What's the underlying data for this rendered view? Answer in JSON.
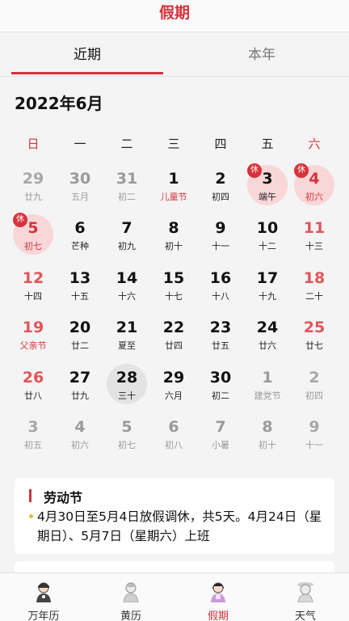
{
  "header": {
    "title": "假期"
  },
  "tabs": [
    {
      "label": "近期",
      "active": true
    },
    {
      "label": "本年",
      "active": false
    }
  ],
  "month_title": "2022年6月",
  "weekdays": [
    "日",
    "一",
    "二",
    "三",
    "四",
    "五",
    "六"
  ],
  "holiday_badge": "休",
  "days": [
    {
      "n": "29",
      "s": "廿九",
      "other": true
    },
    {
      "n": "30",
      "s": "五月",
      "other": true
    },
    {
      "n": "31",
      "s": "初二",
      "other": true
    },
    {
      "n": "1",
      "s": "儿童节",
      "fest": true
    },
    {
      "n": "2",
      "s": "初四"
    },
    {
      "n": "3",
      "s": "端午",
      "rest": true
    },
    {
      "n": "4",
      "s": "初六",
      "rest": true,
      "holidayNum": true
    },
    {
      "n": "5",
      "s": "初七",
      "rest": true,
      "holidayNum": true
    },
    {
      "n": "6",
      "s": "芒种"
    },
    {
      "n": "7",
      "s": "初九"
    },
    {
      "n": "8",
      "s": "初十"
    },
    {
      "n": "9",
      "s": "十一"
    },
    {
      "n": "10",
      "s": "十二"
    },
    {
      "n": "11",
      "s": "十三"
    },
    {
      "n": "12",
      "s": "十四"
    },
    {
      "n": "13",
      "s": "十五"
    },
    {
      "n": "14",
      "s": "十六"
    },
    {
      "n": "15",
      "s": "十七"
    },
    {
      "n": "16",
      "s": "十八"
    },
    {
      "n": "17",
      "s": "十九"
    },
    {
      "n": "18",
      "s": "二十"
    },
    {
      "n": "19",
      "s": "父亲节",
      "fest": true
    },
    {
      "n": "20",
      "s": "廿二"
    },
    {
      "n": "21",
      "s": "夏至"
    },
    {
      "n": "22",
      "s": "廿四"
    },
    {
      "n": "23",
      "s": "廿五"
    },
    {
      "n": "24",
      "s": "廿六"
    },
    {
      "n": "25",
      "s": "廿七"
    },
    {
      "n": "26",
      "s": "廿八"
    },
    {
      "n": "27",
      "s": "廿九"
    },
    {
      "n": "28",
      "s": "三十",
      "today": true
    },
    {
      "n": "29",
      "s": "六月"
    },
    {
      "n": "30",
      "s": "初二"
    },
    {
      "n": "1",
      "s": "建党节",
      "other": true
    },
    {
      "n": "2",
      "s": "初四",
      "other": true
    },
    {
      "n": "3",
      "s": "初五",
      "other": true
    },
    {
      "n": "4",
      "s": "初六",
      "other": true
    },
    {
      "n": "5",
      "s": "初七",
      "other": true
    },
    {
      "n": "6",
      "s": "初八",
      "other": true
    },
    {
      "n": "7",
      "s": "小暑",
      "other": true
    },
    {
      "n": "8",
      "s": "初十",
      "other": true
    },
    {
      "n": "9",
      "s": "十一",
      "other": true
    }
  ],
  "holiday_card": {
    "name": "劳动节",
    "description": "4月30日至5月4日放假调休，共5天。4月24日（星期日）、5月7日（星期六）上班"
  },
  "bottom_nav": [
    {
      "label": "万年历",
      "icon": "wannianli-icon",
      "active": false
    },
    {
      "label": "黄历",
      "icon": "huangli-icon",
      "active": false
    },
    {
      "label": "假期",
      "icon": "jiaqi-icon",
      "active": true
    },
    {
      "label": "天气",
      "icon": "tianqi-icon",
      "active": false
    }
  ],
  "colors": {
    "accent": "#d8323a",
    "rest_bg": "#f9d6d8",
    "today_bg": "#e3e3e3"
  }
}
